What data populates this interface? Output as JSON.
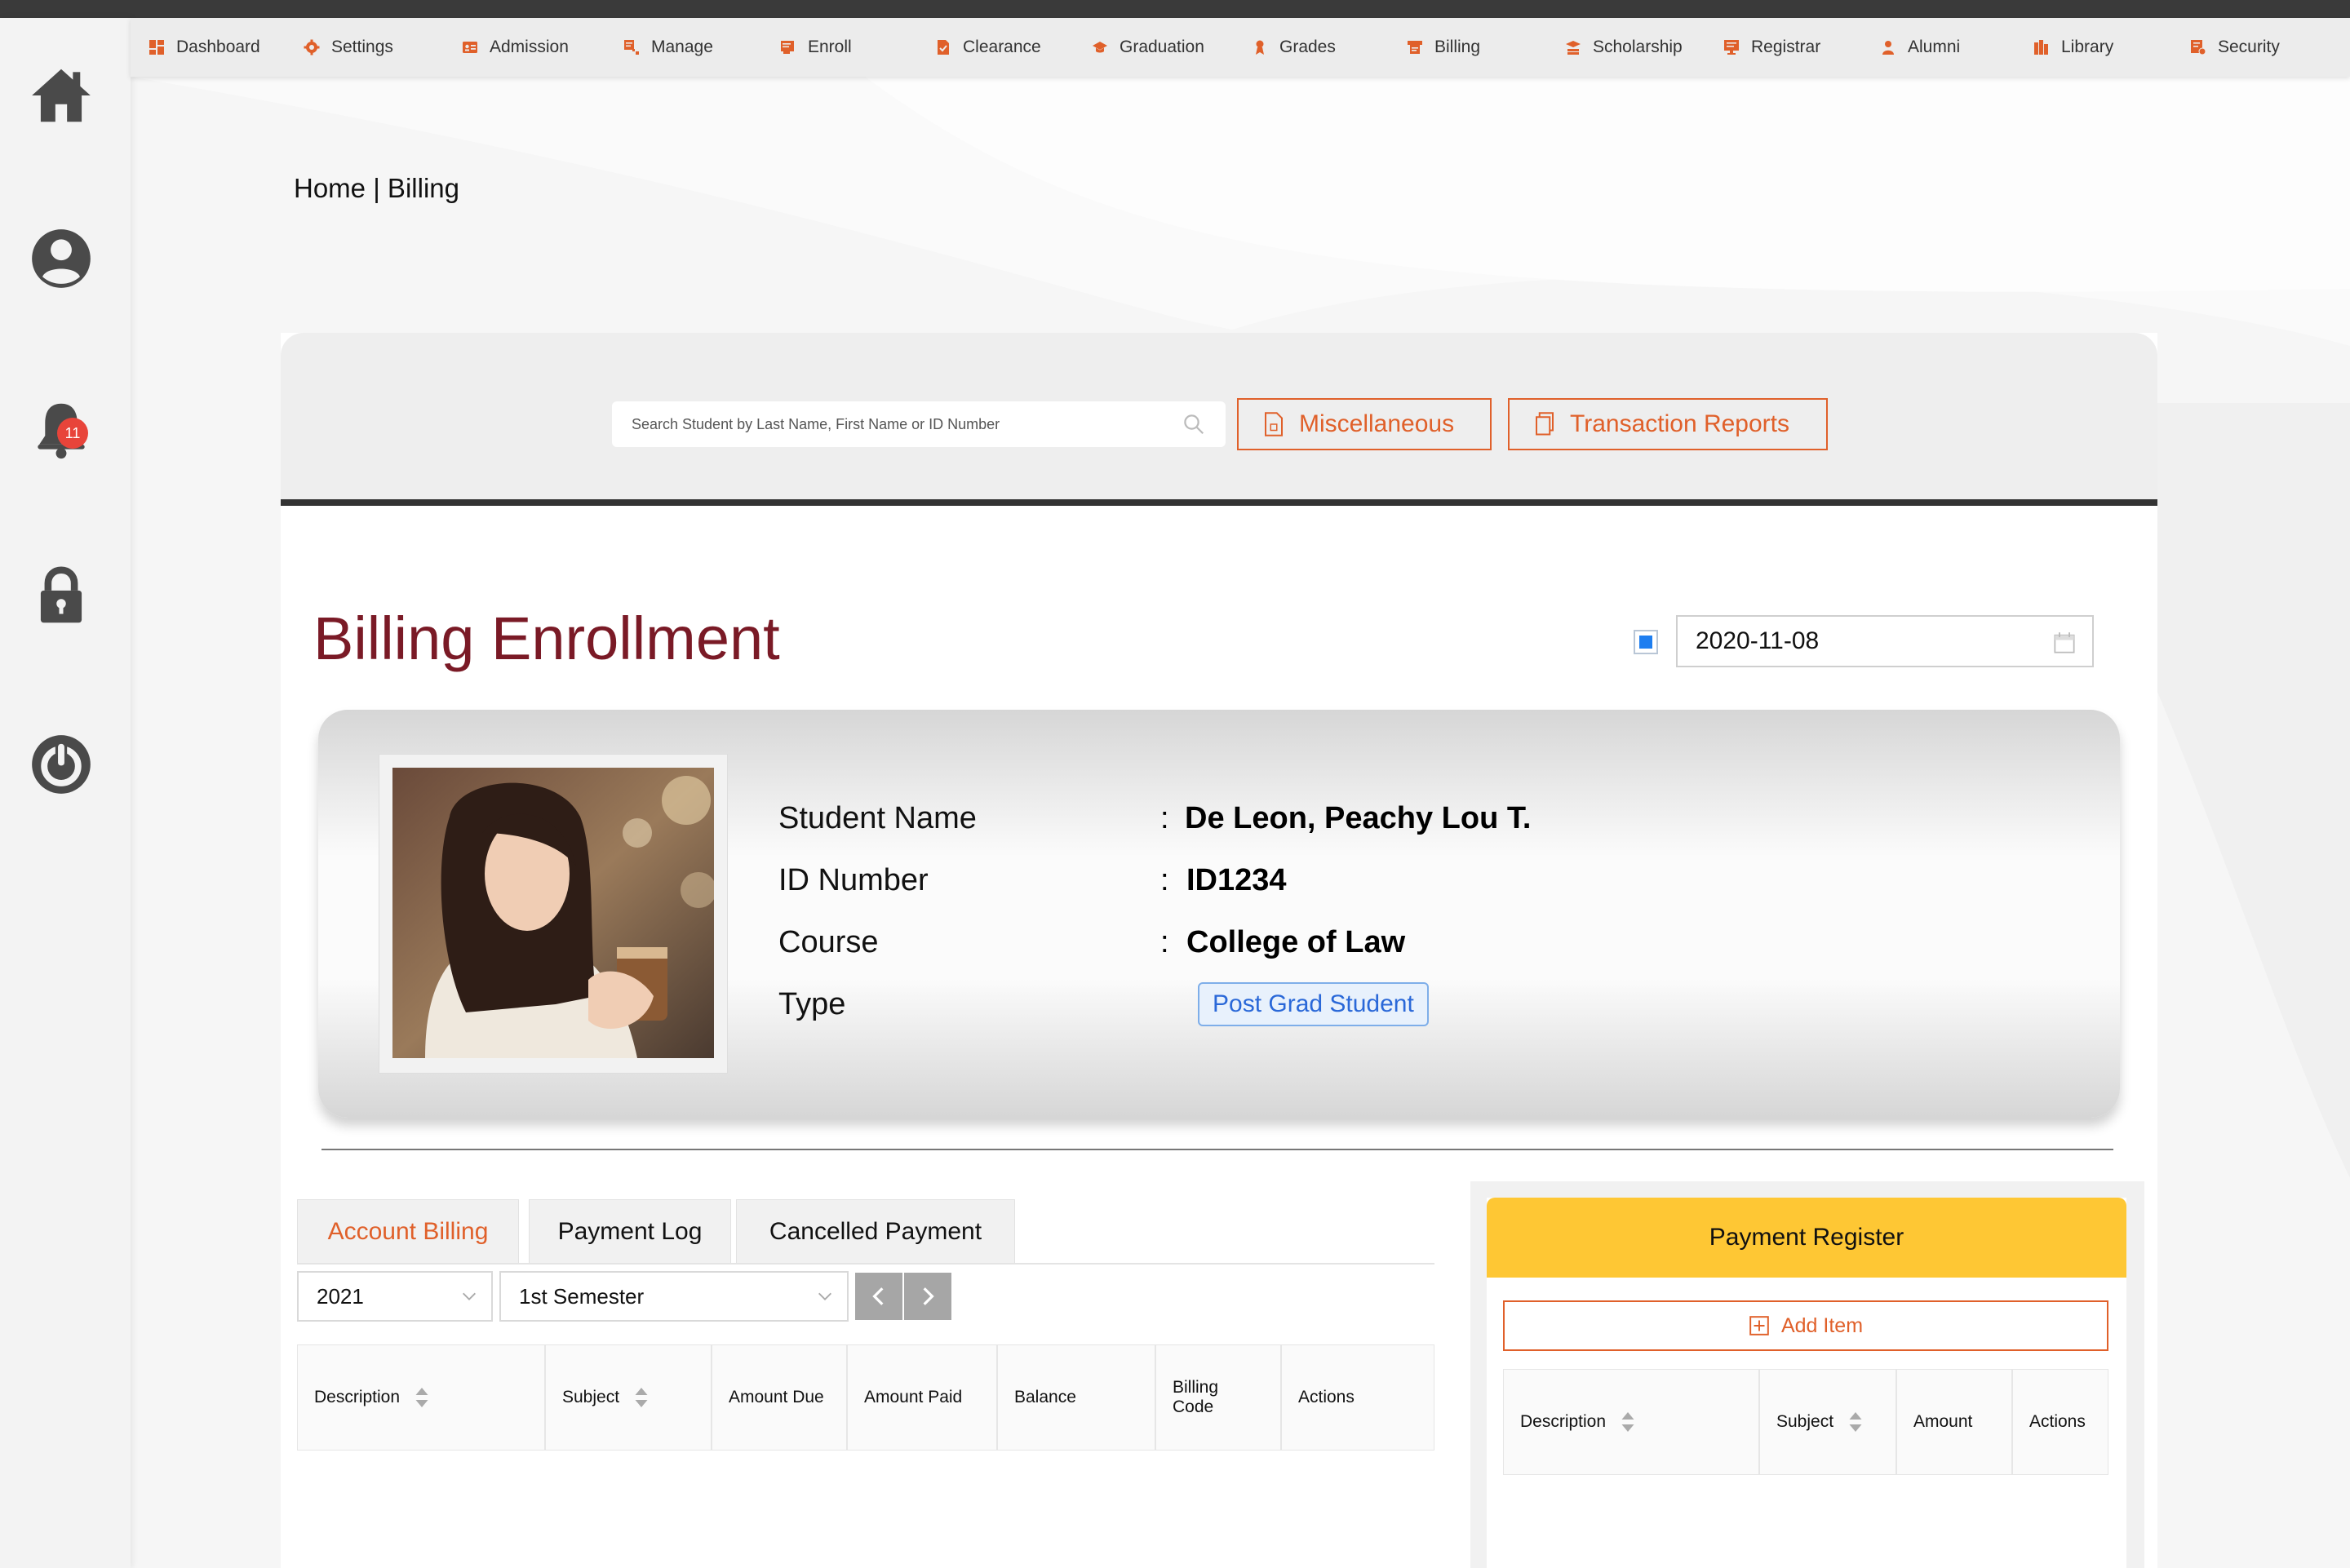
{
  "nav": {
    "items": [
      {
        "label": "Dashboard",
        "icon": "dashboard-icon"
      },
      {
        "label": "Settings",
        "icon": "gear-icon"
      },
      {
        "label": "Admission",
        "icon": "id-card-icon"
      },
      {
        "label": "Manage",
        "icon": "manage-icon"
      },
      {
        "label": "Enroll",
        "icon": "enroll-icon"
      },
      {
        "label": "Clearance",
        "icon": "clearance-icon"
      },
      {
        "label": "Graduation",
        "icon": "graduation-cap-icon"
      },
      {
        "label": "Grades",
        "icon": "grades-icon"
      },
      {
        "label": "Billing",
        "icon": "billing-icon"
      },
      {
        "label": "Scholarship",
        "icon": "scholarship-icon"
      },
      {
        "label": "Registrar",
        "icon": "registrar-icon"
      },
      {
        "label": "Alumni",
        "icon": "alumni-icon"
      },
      {
        "label": "Library",
        "icon": "library-icon"
      },
      {
        "label": "Security",
        "icon": "security-icon"
      }
    ]
  },
  "sidebar": {
    "items": [
      "home-icon",
      "user-icon",
      "bell-icon",
      "lock-icon",
      "power-icon"
    ],
    "notification_count": "11"
  },
  "breadcrumb": "Home | Billing",
  "search": {
    "placeholder": "Search Student by Last Name, First Name or ID Number",
    "misc_label": "Miscellaneous",
    "reports_label": "Transaction Reports"
  },
  "page": {
    "title": "Billing Enrollment",
    "date": "2020-11-08",
    "date_checked": true
  },
  "student": {
    "labels": {
      "name": "Student Name",
      "id": "ID Number",
      "course": "Course",
      "type": "Type"
    },
    "separator": ":",
    "name": "De Leon, Peachy Lou T.",
    "id": "ID1234",
    "course": "College of Law",
    "type": "Post Grad Student"
  },
  "tabs": [
    "Account Billing",
    "Payment Log",
    "Cancelled Payment"
  ],
  "filters": {
    "year": "2021",
    "semester": "1st Semester"
  },
  "billing_table": {
    "columns": [
      "Description",
      "Subject",
      "Amount Due",
      "Amount Paid",
      "Balance",
      "Billing Code",
      "Actions"
    ],
    "rows": []
  },
  "register": {
    "title": "Payment Register",
    "add_label": "Add Item",
    "columns": [
      "Description",
      "Subject",
      "Amount",
      "Actions"
    ],
    "rows": []
  },
  "colors": {
    "accent": "#e0602a",
    "title": "#7a1a26",
    "register_header": "#fec734",
    "pill": "#2a68d8"
  }
}
